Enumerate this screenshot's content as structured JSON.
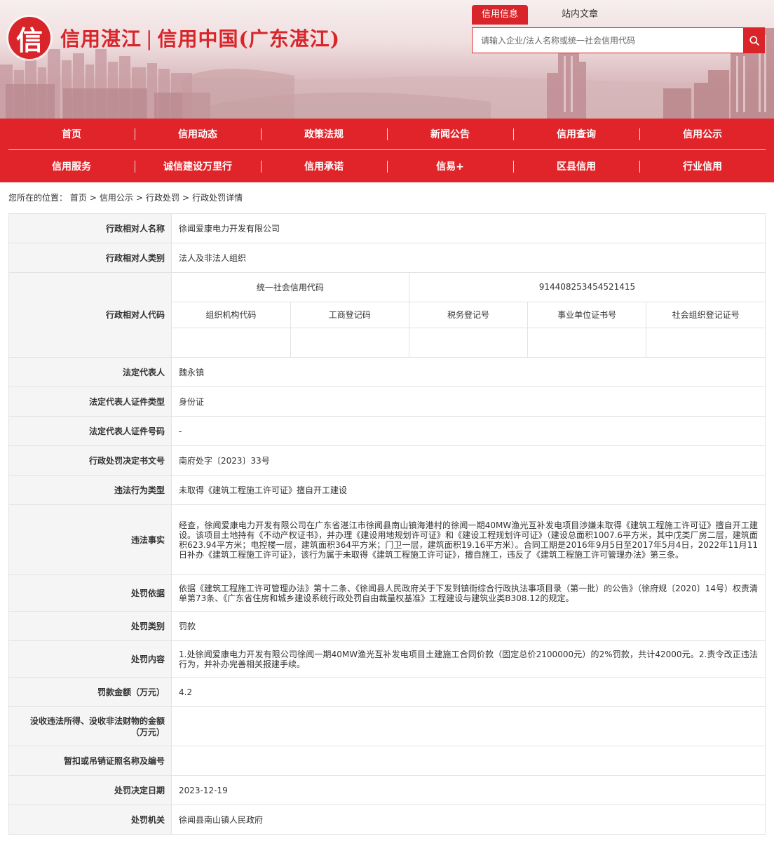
{
  "site": {
    "logo_char": "信",
    "title_left": "信用湛江",
    "title_sep": "|",
    "title_right": "信用中国(广东湛江)"
  },
  "search": {
    "tabs": [
      "信用信息",
      "站内文章"
    ],
    "active_tab": "信用信息",
    "placeholder": "请输入企业/法人名称或统一社会信用代码",
    "button_icon": "search-icon"
  },
  "nav": {
    "row1": [
      "首页",
      "信用动态",
      "政策法规",
      "新闻公告",
      "信用查询",
      "信用公示"
    ],
    "row2": [
      "信用服务",
      "诚信建设万里行",
      "信用承诺",
      "信易+",
      "区县信用",
      "行业信用"
    ]
  },
  "breadcrumb": {
    "prefix": "您所在的位置：",
    "items": [
      "首页",
      "信用公示",
      "行政处罚",
      "行政处罚详情"
    ],
    "separator": ">"
  },
  "detail": {
    "party_name": {
      "label": "行政相对人名称",
      "value": "徐闻爱康电力开发有限公司"
    },
    "party_type": {
      "label": "行政相对人类别",
      "value": "法人及非法人组织"
    },
    "party_codes": {
      "label": "行政相对人代码",
      "uscc_label": "统一社会信用代码",
      "uscc_value": "914408253454521415",
      "columns": [
        "组织机构代码",
        "工商登记码",
        "税务登记号",
        "事业单位证书号",
        "社会组织登记证号"
      ],
      "values": [
        "",
        "",
        "",
        "",
        ""
      ]
    },
    "legal_rep": {
      "label": "法定代表人",
      "value": "魏永镇"
    },
    "legal_rep_id_type": {
      "label": "法定代表人证件类型",
      "value": "身份证"
    },
    "legal_rep_id_no": {
      "label": "法定代表人证件号码",
      "value": "-"
    },
    "decision_no": {
      "label": "行政处罚决定书文号",
      "value": "南府处字〔2023〕33号"
    },
    "violation_type": {
      "label": "违法行为类型",
      "value": "未取得《建筑工程施工许可证》擅自开工建设"
    },
    "facts": {
      "label": "违法事实",
      "value": "经查，徐闻爱康电力开发有限公司在广东省湛江市徐闻县南山镇海港村的徐闻一期40MW渔光互补发电项目涉嫌未取得《建筑工程施工许可证》擅自开工建设。该项目土地持有《不动产权证书》，并办理《建设用地规划许可证》和《建设工程规划许可证》（建设总面积1007.6平方米，其中戊类厂房二层，建筑面积623.94平方米；电控楼一层，建筑面积364平方米；门卫一层，建筑面积19.16平方米）。合同工期是2016年9月5日至2017年5月4日，2022年11月11日补办《建筑工程施工许可证》，该行为属于未取得《建筑工程施工许可证》，擅自施工，违反了《建筑工程施工许可管理办法》第三条。"
    },
    "basis": {
      "label": "处罚依据",
      "value": "依据《建筑工程施工许可管理办法》第十二条、《徐闻县人民政府关于下发到镇街综合行政执法事项目录（第一批）的公告》（徐府规〔2020〕14号）权责清单第73条、《广东省住房和城乡建设系统行政处罚自由裁量权基准》工程建设与建筑业类B308.12的规定。"
    },
    "category": {
      "label": "处罚类别",
      "value": "罚款"
    },
    "content": {
      "label": "处罚内容",
      "value": "1.处徐闻爱康电力开发有限公司徐闻一期40MW渔光互补发电项目土建施工合同价款（固定总价2100000元）的2%罚款，共计42000元。2.责令改正违法行为，并补办完善相关报建手续。"
    },
    "fine": {
      "label": "罚款金额（万元）",
      "value": "4.2"
    },
    "confiscation": {
      "label": "没收违法所得、没收非法财物的金额（万元）",
      "value": ""
    },
    "license": {
      "label": "暂扣或吊销证照名称及编号",
      "value": ""
    },
    "decision_date": {
      "label": "处罚决定日期",
      "value": "2023-12-19"
    },
    "authority": {
      "label": "处罚机关",
      "value": "徐闻县南山镇人民政府"
    }
  },
  "colors": {
    "brand_red": "#e02429",
    "label_bg": "#f5f5f5",
    "border": "#e3e3e3"
  }
}
